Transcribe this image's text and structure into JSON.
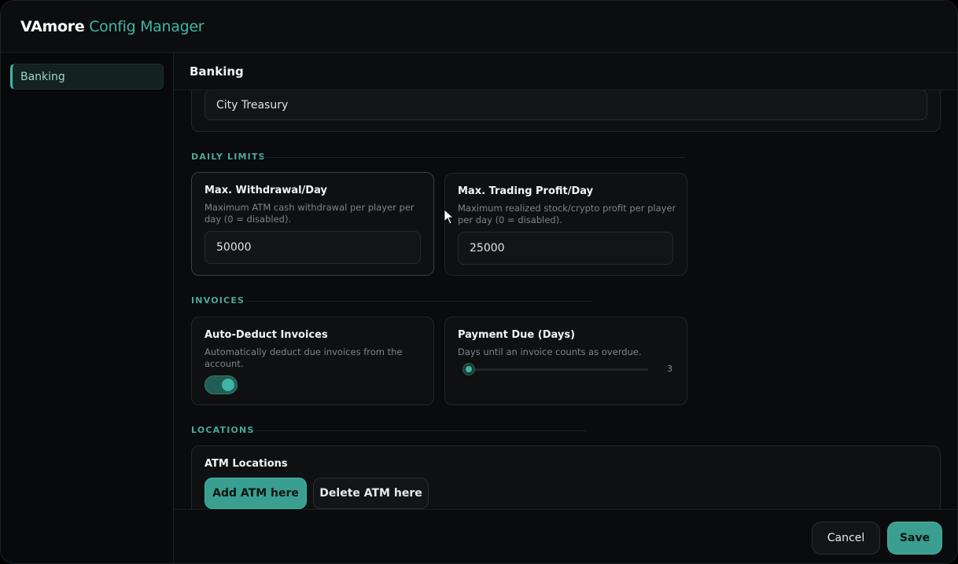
{
  "window": {
    "brand": "VAmore",
    "title_rest": "Config Manager"
  },
  "sidebar": {
    "items": [
      {
        "label": "Banking"
      }
    ]
  },
  "main": {
    "header": "Banking",
    "account_field": {
      "value": "City Treasury"
    },
    "sections": {
      "daily_limits": "DAILY LIMITS",
      "invoices": "INVOICES",
      "locations": "LOCATIONS"
    },
    "withdrawal": {
      "title": "Max. Withdrawal/Day",
      "desc": "Maximum ATM cash withdrawal per player per day (0 = disabled).",
      "value": "50000"
    },
    "trading": {
      "title": "Max. Trading Profit/Day",
      "desc": "Maximum realized stock/crypto profit per player per day (0 = disabled).",
      "value": "25000"
    },
    "auto_deduct": {
      "title": "Auto-Deduct Invoices",
      "desc": "Automatically deduct due invoices from the account.",
      "enabled": true
    },
    "payment_due": {
      "title": "Payment Due (Days)",
      "desc": "Days until an invoice counts as overdue.",
      "value": "3"
    },
    "atm": {
      "title": "ATM Locations",
      "add_label": "Add ATM here",
      "delete_label": "Delete ATM here"
    }
  },
  "footer": {
    "cancel_label": "Cancel",
    "save_label": "Save"
  },
  "colors": {
    "accent": "#3fb6a4",
    "background": "#090b0d"
  }
}
